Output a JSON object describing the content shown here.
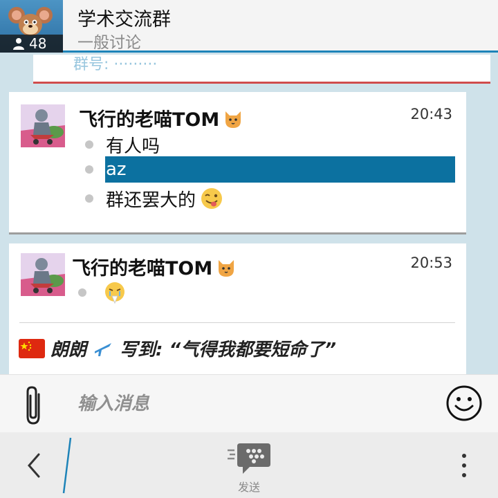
{
  "header": {
    "group_name": "学术交流群",
    "group_category": "一般讨论",
    "member_count": "48",
    "avatar_icon": "cartoon-mouse-avatar",
    "member_icon": "person-icon"
  },
  "previous_message": {
    "text": "群号:  ·········"
  },
  "messages": [
    {
      "sender": "飞行的老喵TOM",
      "sender_badge_icon": "cat-emoji-icon",
      "time": "20:43",
      "lines": [
        {
          "text": "有人吗",
          "emoji": ""
        },
        {
          "text": "az",
          "emoji": "",
          "selected": true
        },
        {
          "text": "群还罢大的",
          "emoji": "winking-tongue-emoji"
        }
      ]
    },
    {
      "sender": "飞行的老喵TOM",
      "sender_badge_icon": "cat-emoji-icon",
      "time": "20:53",
      "lines": [
        {
          "text": "",
          "emoji": "crying-pray-emoji"
        }
      ],
      "quote": {
        "flag_icon": "china-flag-icon",
        "name": "朗朗",
        "name_icon": "airplane-icon",
        "text": "写到: “气得我都要短命了”"
      }
    }
  ],
  "composer": {
    "placeholder": "输入消息",
    "value": ""
  },
  "action_bar": {
    "send_label": "发送"
  },
  "colors": {
    "accent": "#0c71a0",
    "header_bar": "#1d83b8",
    "background": "#cfe2ea",
    "previous_card_border": "#d04c4c"
  }
}
